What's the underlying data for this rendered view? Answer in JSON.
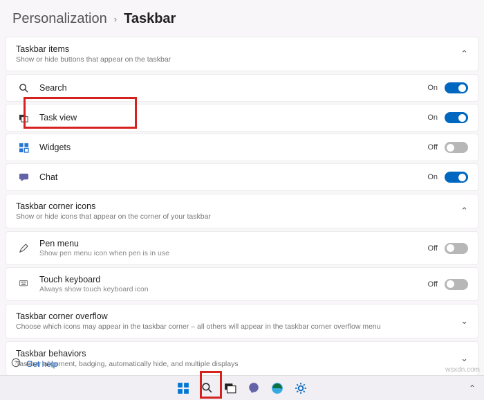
{
  "breadcrumb": {
    "parent": "Personalization",
    "current": "Taskbar"
  },
  "sections": {
    "items": {
      "title": "Taskbar items",
      "desc": "Show or hide buttons that appear on the taskbar",
      "rows": {
        "search": {
          "label": "Search",
          "state": "On"
        },
        "taskview": {
          "label": "Task view",
          "state": "On"
        },
        "widgets": {
          "label": "Widgets",
          "state": "Off"
        },
        "chat": {
          "label": "Chat",
          "state": "On"
        }
      }
    },
    "cornerIcons": {
      "title": "Taskbar corner icons",
      "desc": "Show or hide icons that appear on the corner of your taskbar",
      "rows": {
        "pen": {
          "label": "Pen menu",
          "sub": "Show pen menu icon when pen is in use",
          "state": "Off"
        },
        "kbd": {
          "label": "Touch keyboard",
          "sub": "Always show touch keyboard icon",
          "state": "Off"
        }
      }
    },
    "overflow": {
      "title": "Taskbar corner overflow",
      "desc": "Choose which icons may appear in the taskbar corner – all others will appear in the taskbar corner overflow menu"
    },
    "behaviors": {
      "title": "Taskbar behaviors",
      "desc": "Taskbar alignment, badging, automatically hide, and multiple displays"
    }
  },
  "help": {
    "label": "Get help"
  },
  "watermark": "wsxdn.com"
}
